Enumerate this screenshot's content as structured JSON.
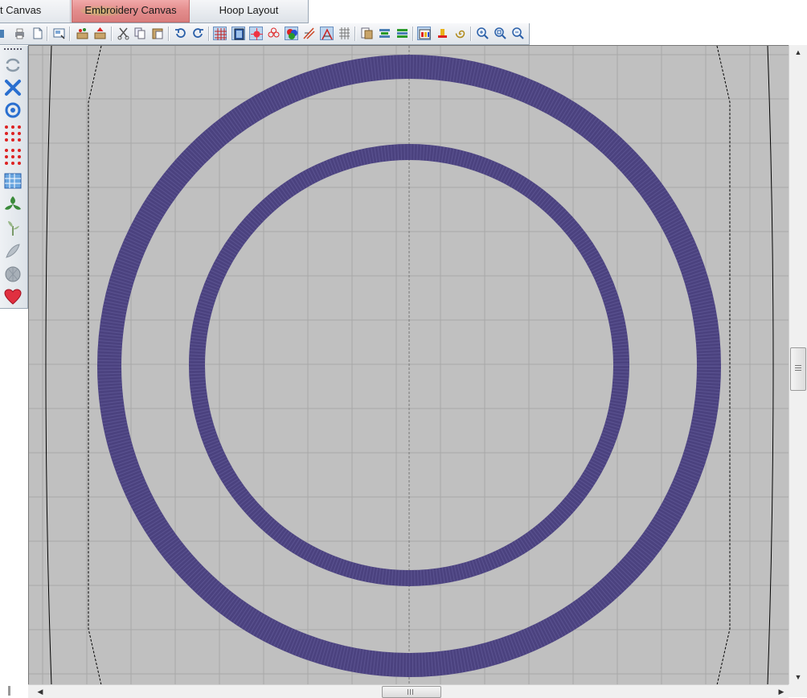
{
  "tabs": [
    {
      "label": "t Canvas",
      "active": false
    },
    {
      "label": "Embroidery Canvas",
      "active": true
    },
    {
      "label": "Hoop Layout",
      "active": false
    }
  ],
  "toolbar": {
    "buttons": [
      "open-icon",
      "print-icon",
      "page-setup-icon",
      "preview-icon",
      "import-icon",
      "export-icon",
      "cut-icon",
      "copy-icon",
      "paste-icon",
      "undo-icon",
      "redo-icon",
      "grid-icon",
      "hoop-icon",
      "stitch-icon",
      "flower-icon",
      "color-icon",
      "split-icon",
      "matrix-icon",
      "layers-icon",
      "align-icon",
      "sequence-icon",
      "palette-icon",
      "stamp-icon",
      "spiral-icon",
      "zoom-in-icon",
      "zoom-fit-icon",
      "zoom-out-icon"
    ]
  },
  "sidebar": {
    "buttons": [
      "rotate-icon",
      "cross-stitch-icon",
      "knot-icon",
      "dots-grid-icon",
      "dots-grid-alt-icon",
      "fill-grid-icon",
      "motif-icon",
      "plant-icon",
      "feather-icon",
      "shell-icon",
      "heart-icon"
    ]
  },
  "colors": {
    "canvas_bg": "#c0c0c0",
    "grid_line": "#a8a8a8",
    "thread": "#4b427f",
    "thread_highlight": "#6a62a0",
    "active_tab": "#e48e8e"
  },
  "design": {
    "outer_ring": {
      "thread_color": "#4b427f"
    },
    "inner_ring": {
      "thread_color": "#4b427f"
    }
  }
}
